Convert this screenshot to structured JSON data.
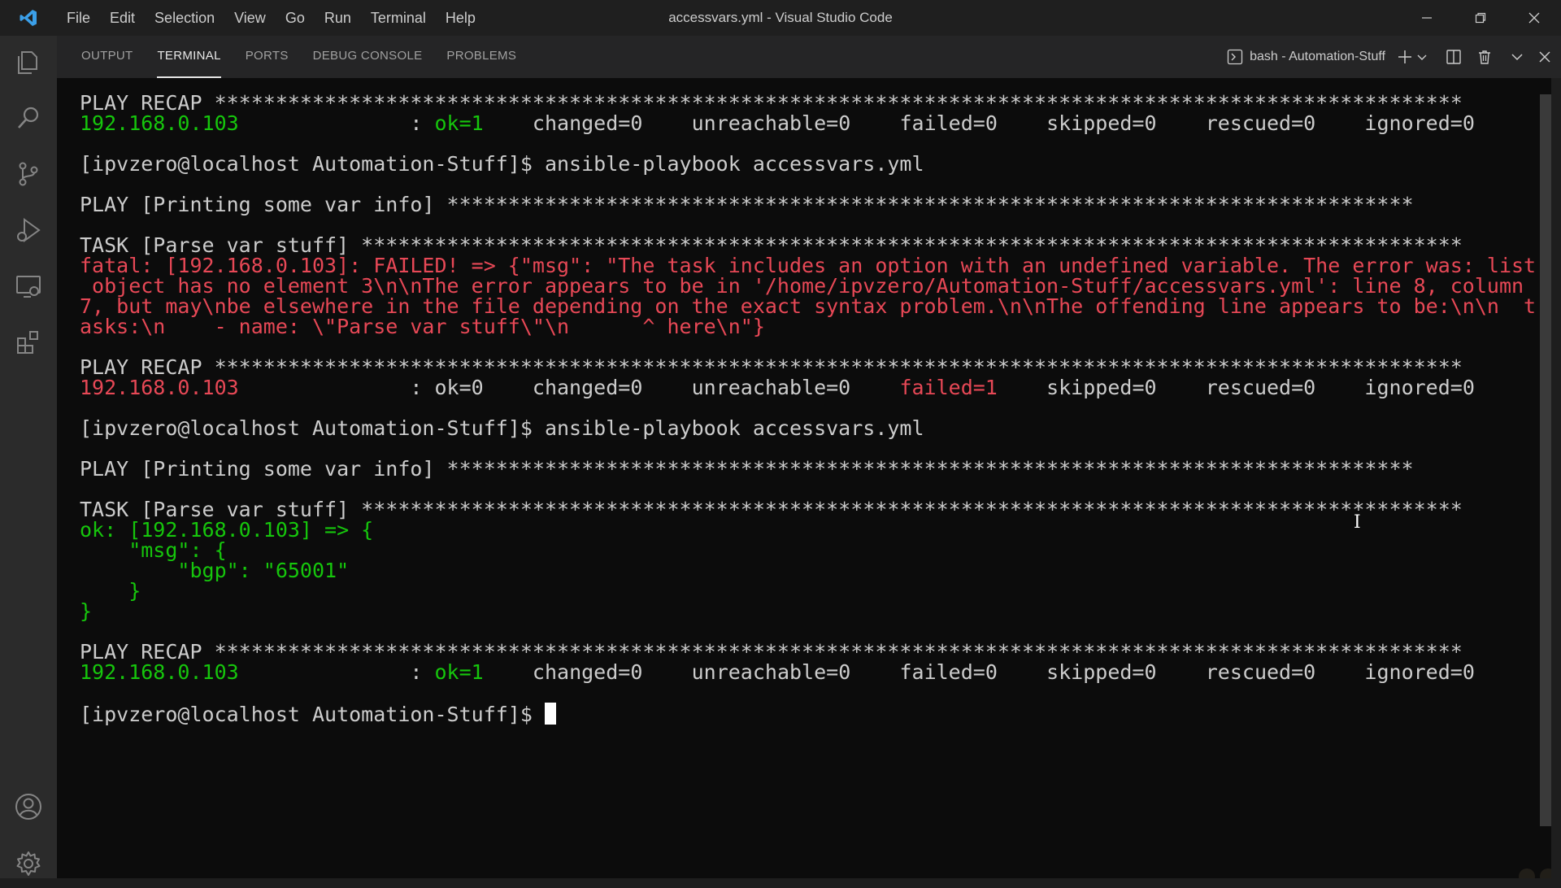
{
  "window": {
    "title": "accessvars.yml - Visual Studio Code"
  },
  "menu": {
    "items": [
      "File",
      "Edit",
      "Selection",
      "View",
      "Go",
      "Run",
      "Terminal",
      "Help"
    ]
  },
  "panel": {
    "tabs": [
      {
        "label": "OUTPUT",
        "active": false
      },
      {
        "label": "TERMINAL",
        "active": true
      },
      {
        "label": "PORTS",
        "active": false
      },
      {
        "label": "DEBUG CONSOLE",
        "active": false
      },
      {
        "label": "PROBLEMS",
        "active": false
      }
    ],
    "terminal_name": "bash - Automation-Stuff"
  },
  "colors": {
    "green": "#16c60c",
    "red": "#e74856",
    "plain": "#cccccc",
    "background": "#0c0c0c"
  },
  "terminal": {
    "prompt": "[ipvzero@localhost Automation-Stuff]$ ",
    "lines": [
      [
        {
          "t": "PLAY RECAP ******************************************************************************************************",
          "c": "plain"
        }
      ],
      [
        {
          "t": "192.168.0.103",
          "c": "green"
        },
        {
          "t": "              : ",
          "c": "plain"
        },
        {
          "t": "ok=1",
          "c": "green"
        },
        {
          "t": "    changed=0    unreachable=0    failed=0    skipped=0    rescued=0    ignored=0",
          "c": "plain"
        }
      ],
      [],
      [
        {
          "t": "[ipvzero@localhost Automation-Stuff]$ ansible-playbook accessvars.yml",
          "c": "plain"
        }
      ],
      [],
      [
        {
          "t": "PLAY [Printing some var info] *******************************************************************************",
          "c": "plain"
        }
      ],
      [],
      [
        {
          "t": "TASK [Parse var stuff] ******************************************************************************************",
          "c": "plain"
        }
      ],
      [
        {
          "t": "fatal: [192.168.0.103]: FAILED! => {\"msg\": \"The task includes an option with an undefined variable. The error was: list",
          "c": "red"
        }
      ],
      [
        {
          "t": " object has no element 3\\n\\nThe error appears to be in '/home/ipvzero/Automation-Stuff/accessvars.yml': line 8, column",
          "c": "red"
        }
      ],
      [
        {
          "t": "7, but may\\nbe elsewhere in the file depending on the exact syntax problem.\\n\\nThe offending line appears to be:\\n\\n  t",
          "c": "red"
        }
      ],
      [
        {
          "t": "asks:\\n    - name: \\\"Parse var stuff\\\"\\n      ^ here\\n\"}",
          "c": "red"
        }
      ],
      [],
      [
        {
          "t": "PLAY RECAP ******************************************************************************************************",
          "c": "plain"
        }
      ],
      [
        {
          "t": "192.168.0.103",
          "c": "red"
        },
        {
          "t": "              : ok=0    changed=0    unreachable=0    ",
          "c": "plain"
        },
        {
          "t": "failed=1",
          "c": "red"
        },
        {
          "t": "    skipped=0    rescued=0    ignored=0",
          "c": "plain"
        }
      ],
      [],
      [
        {
          "t": "[ipvzero@localhost Automation-Stuff]$ ansible-playbook accessvars.yml",
          "c": "plain"
        }
      ],
      [],
      [
        {
          "t": "PLAY [Printing some var info] *******************************************************************************",
          "c": "plain"
        }
      ],
      [],
      [
        {
          "t": "TASK [Parse var stuff] ******************************************************************************************",
          "c": "plain"
        }
      ],
      [
        {
          "t": "ok: [192.168.0.103] => {",
          "c": "green"
        }
      ],
      [
        {
          "t": "    \"msg\": {",
          "c": "green"
        }
      ],
      [
        {
          "t": "        \"bgp\": \"65001\"",
          "c": "green"
        }
      ],
      [
        {
          "t": "    }",
          "c": "green"
        }
      ],
      [
        {
          "t": "}",
          "c": "green"
        }
      ],
      [],
      [
        {
          "t": "PLAY RECAP ******************************************************************************************************",
          "c": "plain"
        }
      ],
      [
        {
          "t": "192.168.0.103",
          "c": "green"
        },
        {
          "t": "              : ",
          "c": "plain"
        },
        {
          "t": "ok=1",
          "c": "green"
        },
        {
          "t": "    changed=0    unreachable=0    failed=0    skipped=0    rescued=0    ignored=0",
          "c": "plain"
        }
      ],
      [],
      [
        {
          "t": "[ipvzero@localhost Automation-Stuff]$ ",
          "c": "plain"
        },
        {
          "cursor": true
        }
      ]
    ]
  }
}
